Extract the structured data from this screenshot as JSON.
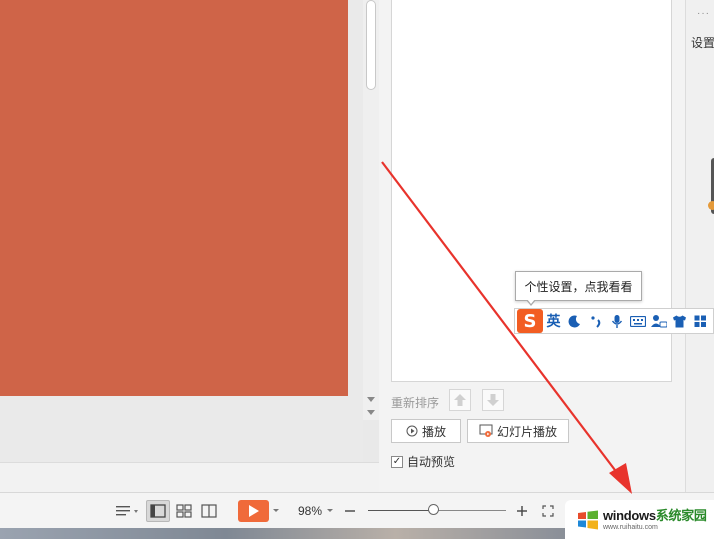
{
  "animation_pane": {
    "reorder_label": "重新排序",
    "play_label": "播放",
    "slideshow_label": "幻灯片播放",
    "auto_preview_label": "自动预览",
    "auto_preview_checked": true
  },
  "right_sidebar": {
    "more_icon": "···",
    "settings_label": "设置"
  },
  "ime": {
    "tooltip": "个性设置，点我看看",
    "logo": "S",
    "lang": "英",
    "icons": [
      "moon-icon",
      "punctuation-icon",
      "microphone-icon",
      "keyboard-icon",
      "user-settings-icon",
      "skin-icon",
      "toolbox-icon"
    ],
    "accent_color": "#1a5fb4"
  },
  "status_bar": {
    "zoom_value": "98%",
    "zoom_fraction": 0.47
  },
  "watermark": {
    "main_a": "windows",
    "main_b": "系统家园",
    "url": "www.ruihaitu.com"
  },
  "colors": {
    "slide": "#cf6448",
    "play_button": "#f06a3a",
    "arrow": "#e8332c"
  }
}
